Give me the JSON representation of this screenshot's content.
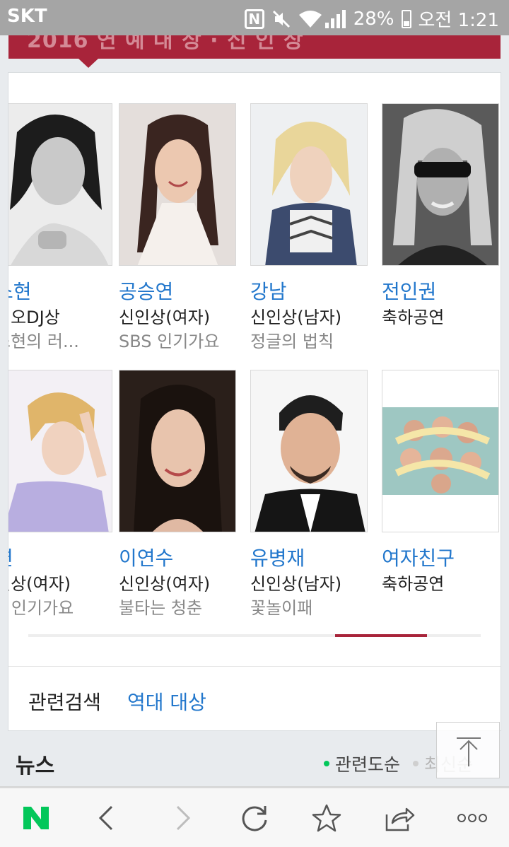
{
  "status_bar": {
    "carrier": "SKT",
    "battery": "28%",
    "time": "오전 1:21",
    "icons": [
      "nfc-icon",
      "mute-icon",
      "wifi-icon",
      "signal-icon",
      "battery-icon"
    ]
  },
  "section_header": {
    "title_fragment": "2016 연 예 대 상 · 신 인 상"
  },
  "row1": [
    {
      "name": "소현",
      "award": "디오DJ상",
      "program": "소현의 러..."
    },
    {
      "name": "공승연",
      "award": "신인상(여자)",
      "program": "SBS 인기가요"
    },
    {
      "name": "강남",
      "award": "신인상(남자)",
      "program": "정글의 법칙"
    },
    {
      "name": "전인권",
      "award": "축하공연",
      "program": ""
    }
  ],
  "row2": [
    {
      "name": "연",
      "award": "인상(여자)",
      "program": "S 인기가요"
    },
    {
      "name": "이연수",
      "award": "신인상(여자)",
      "program": "불타는 청춘"
    },
    {
      "name": "유병재",
      "award": "신인상(남자)",
      "program": "꽃놀이패"
    },
    {
      "name": "여자친구",
      "award": "축하공연",
      "program": ""
    }
  ],
  "carousel": {
    "scroll_position": 0.85
  },
  "related": {
    "label": "관련검색",
    "link": "역대 대상"
  },
  "news": {
    "title": "뉴스",
    "sort_active": "관련도순",
    "sort_inactive": "최신순"
  },
  "bottom_bar": {
    "icons": [
      "naver-home-icon",
      "back-icon",
      "forward-icon",
      "refresh-icon",
      "bookmark-star-icon",
      "share-icon",
      "more-icon"
    ]
  },
  "colors": {
    "accent_red": "#a8243a",
    "link_blue": "#2277cc",
    "naver_green": "#03c75a"
  }
}
